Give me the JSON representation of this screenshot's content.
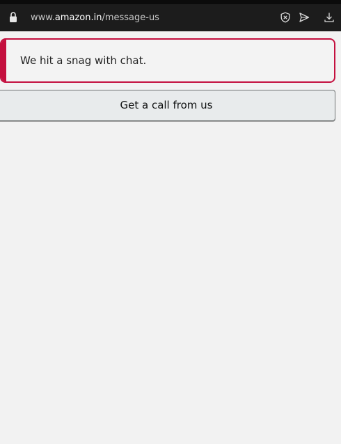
{
  "browser": {
    "url_prefix": "www.",
    "url_domain": "amazon.in",
    "url_path": "/message-us",
    "icons": {
      "lock": "lock-icon",
      "privacy": "shield-x-icon",
      "send": "send-icon",
      "download": "download-icon"
    }
  },
  "main": {
    "error_message": "We hit a snag with chat.",
    "call_button_label": "Get a call from us"
  },
  "colors": {
    "error_accent": "#c40f3e",
    "button_bg": "#e8ebec",
    "page_bg": "#f2f2f2"
  }
}
